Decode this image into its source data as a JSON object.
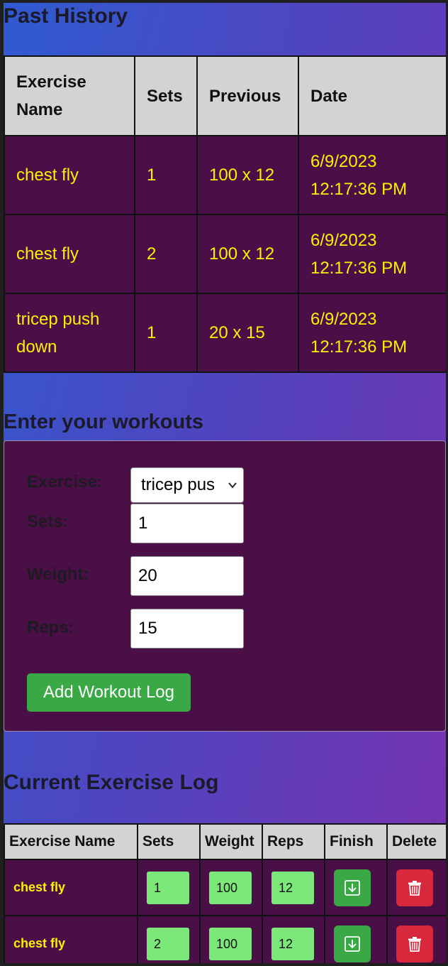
{
  "history": {
    "title": "Past History",
    "columns": [
      "Exercise Name",
      "Sets",
      "Previous",
      "Date"
    ],
    "rows": [
      {
        "exercise": "chest fly",
        "sets": "1",
        "previous": "100 x 12",
        "date": "6/9/2023 12:17:36 PM"
      },
      {
        "exercise": "chest fly",
        "sets": "2",
        "previous": "100 x 12",
        "date": "6/9/2023 12:17:36 PM"
      },
      {
        "exercise": "tricep push down",
        "sets": "1",
        "previous": "20 x 15",
        "date": "6/9/2023 12:17:36 PM"
      }
    ]
  },
  "form": {
    "title": "Enter your workouts",
    "exercise_label": "Exercise:",
    "exercise_value": "tricep pus",
    "sets_label": "Sets:",
    "sets_value": "1",
    "weight_label": "Weight:",
    "weight_value": "20",
    "reps_label": "Reps:",
    "reps_value": "15",
    "add_button": "Add Workout Log"
  },
  "current": {
    "title": "Current Exercise Log",
    "columns": [
      "Exercise Name",
      "Sets",
      "Weight",
      "Reps",
      "Finish",
      "Delete"
    ],
    "rows": [
      {
        "exercise": "chest fly",
        "sets": "1",
        "weight": "100",
        "reps": "12"
      },
      {
        "exercise": "chest fly",
        "sets": "2",
        "weight": "100",
        "reps": "12"
      }
    ]
  },
  "colors": {
    "row_bg": "#4a0f47",
    "row_text": "#ffef00",
    "header_bg": "#d3d3d3",
    "add_button": "#3aa845",
    "finish_button": "#3aa845",
    "delete_button": "#d7283c",
    "stepper_bg": "#7de87a"
  },
  "icons": {
    "finish": "download-box-icon",
    "delete": "trash-icon",
    "select": "chevron-down-icon"
  }
}
